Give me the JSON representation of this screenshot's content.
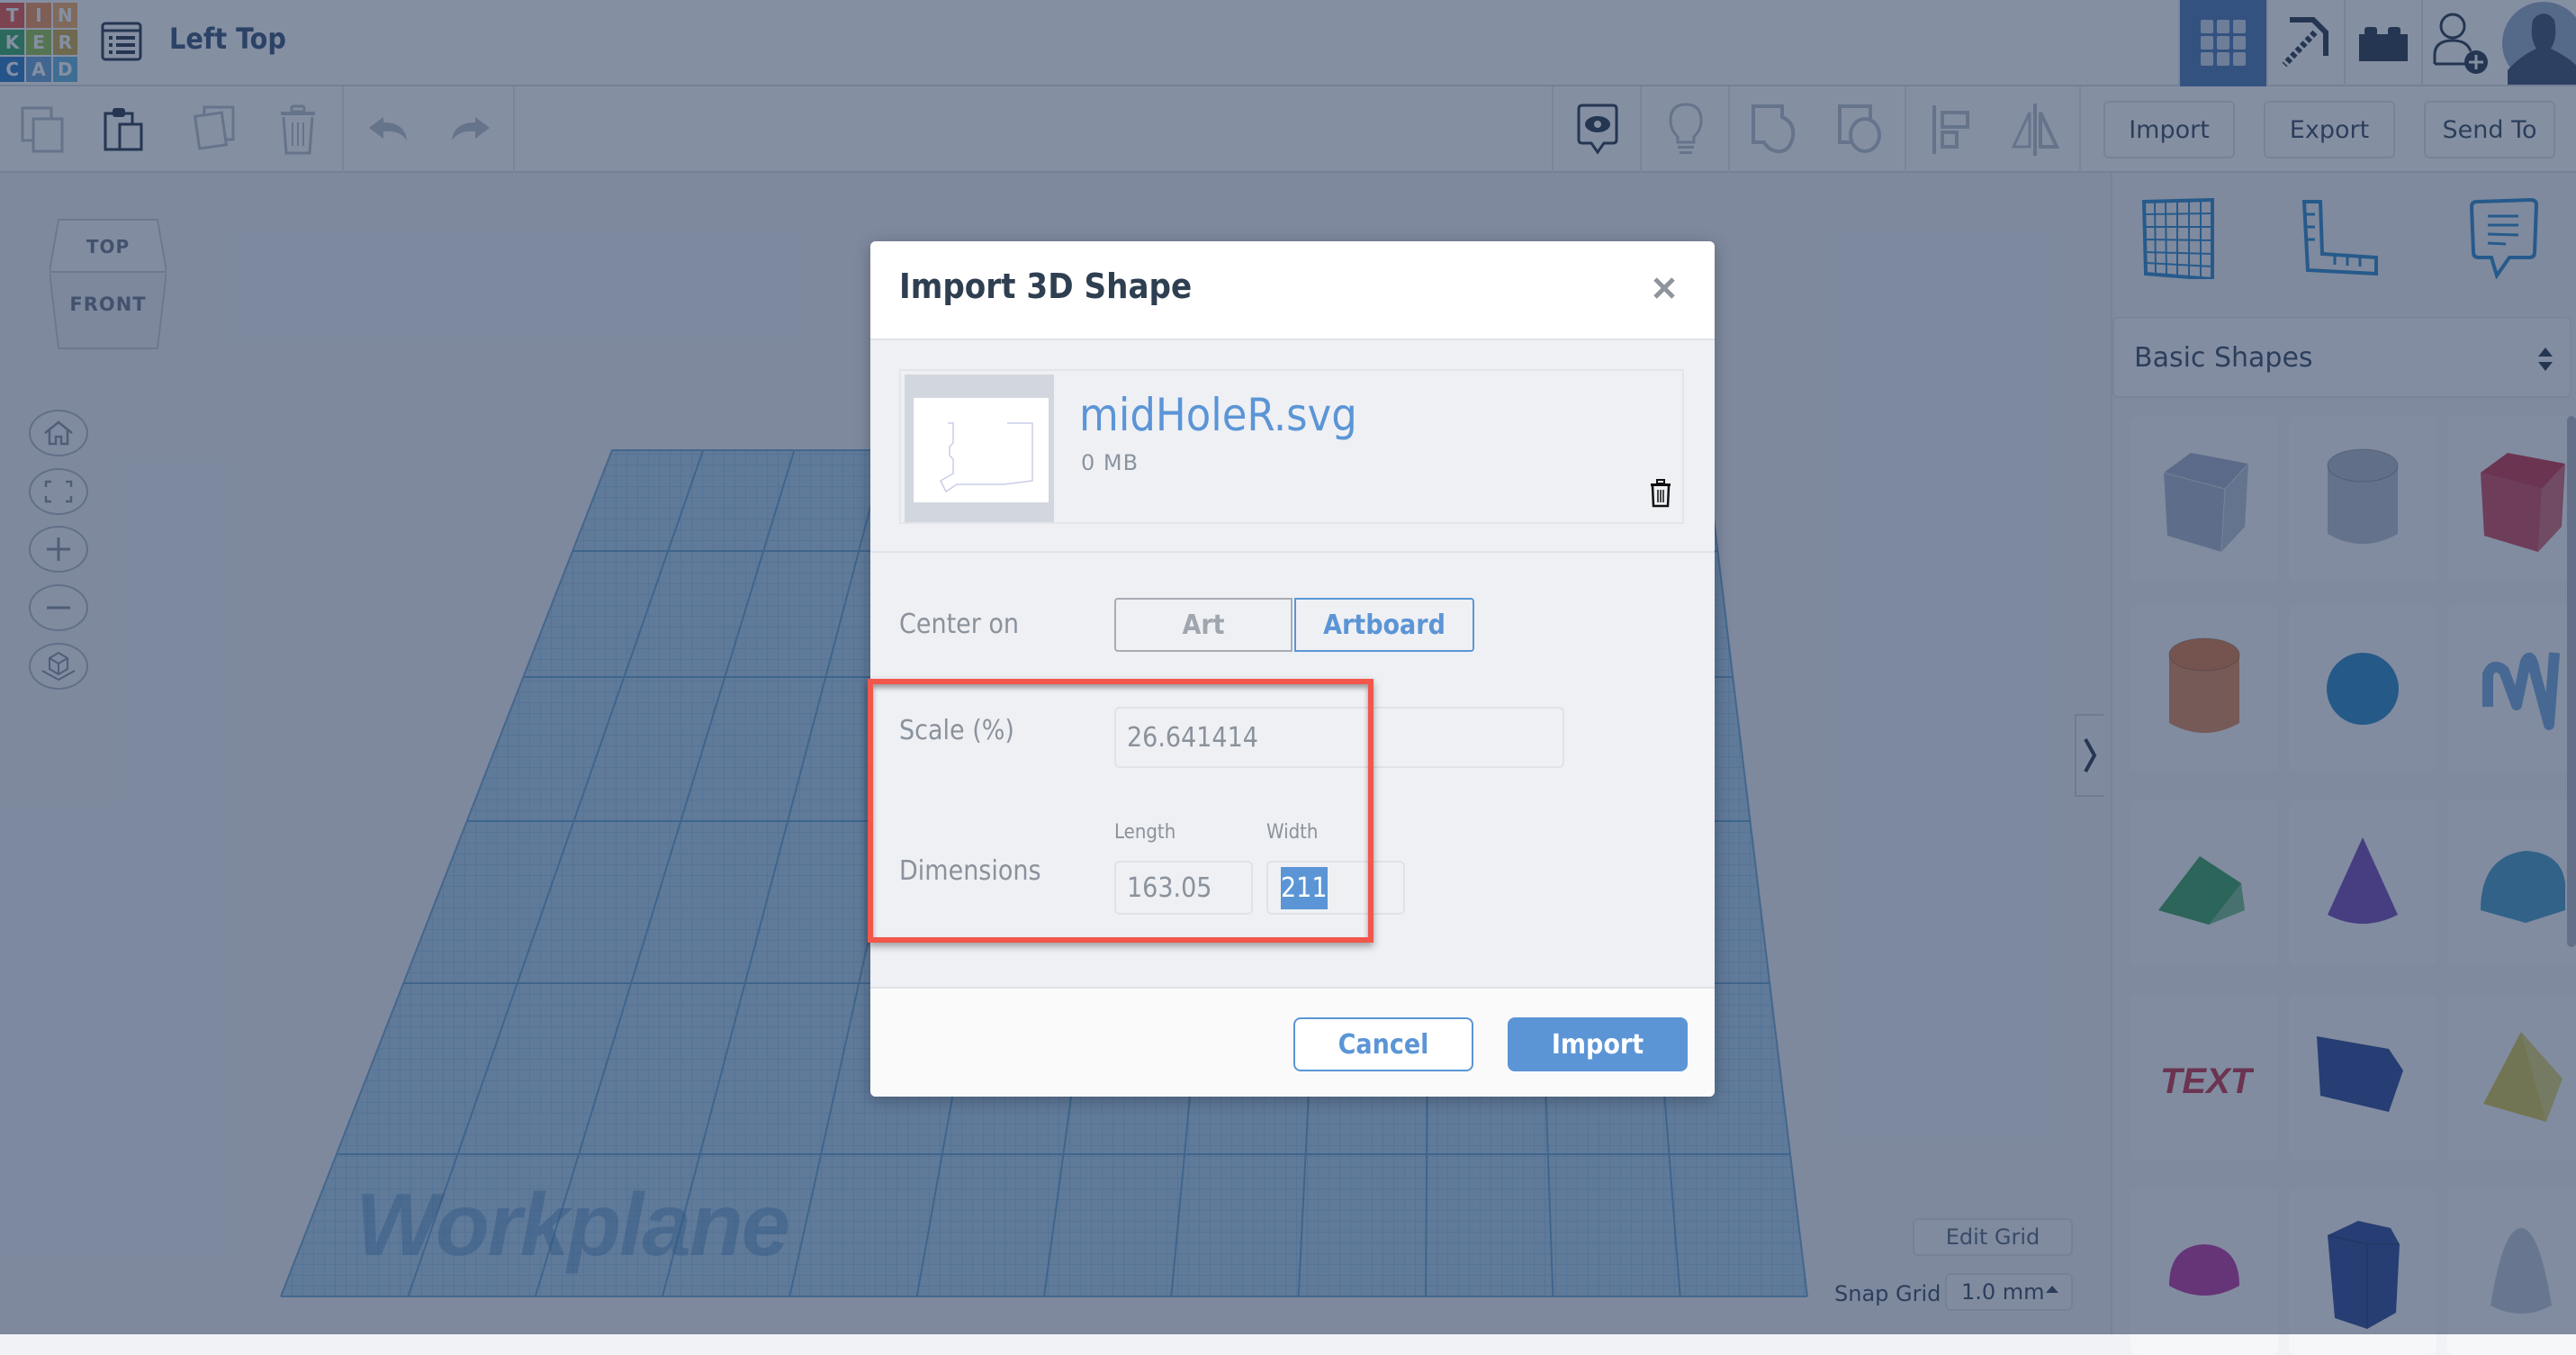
{
  "app": {
    "logo_letters": [
      "T",
      "I",
      "N",
      "K",
      "E",
      "R",
      "C",
      "A",
      "D"
    ],
    "logo_colors": [
      "#e84c3d",
      "#f08a4b",
      "#f2a65a",
      "#2aa55b",
      "#8cbf3f",
      "#c9a43a",
      "#1c73c6",
      "#5d9ed8",
      "#5ab1de"
    ],
    "design_title": "Left Top"
  },
  "topbar": {
    "icons": [
      {
        "name": "3d-design-grid-icon",
        "active": true
      },
      {
        "name": "minecraft-pickaxe-icon",
        "active": false
      },
      {
        "name": "lego-brick-icon",
        "active": false
      },
      {
        "name": "add-user-icon",
        "active": false
      },
      {
        "name": "user-avatar",
        "active": false
      }
    ]
  },
  "toolbar": {
    "left_icons": [
      "copy-icon",
      "paste-icon",
      "duplicate-icon",
      "delete-icon",
      "undo-icon",
      "redo-icon"
    ],
    "right_icons": [
      "show-notes-icon",
      "lightbulb-icon",
      "group-icon",
      "ungroup-icon",
      "align-icon",
      "mirror-icon"
    ],
    "import_label": "Import",
    "export_label": "Export",
    "sendto_label": "Send To"
  },
  "viewcube": {
    "top_label": "TOP",
    "front_label": "FRONT"
  },
  "nav_buttons": [
    "home-view-icon",
    "fit-view-icon",
    "zoom-in-icon",
    "zoom-out-icon",
    "perspective-icon"
  ],
  "workplane": {
    "label": "Workplane",
    "edit_grid_label": "Edit Grid",
    "snap_grid_label": "Snap Grid",
    "snap_grid_value": "1.0 mm"
  },
  "right_panel": {
    "tool_icons": [
      "workplane-icon",
      "ruler-icon",
      "notes-icon"
    ],
    "category": "Basic Shapes",
    "shapes": [
      {
        "name": "box-hole",
        "color": "#9aa8c0"
      },
      {
        "name": "cylinder-hole",
        "color": "#a9b3c4"
      },
      {
        "name": "box",
        "color": "#c2283e"
      },
      {
        "name": "cylinder",
        "color": "#d9733a"
      },
      {
        "name": "sphere",
        "color": "#1c7fc2"
      },
      {
        "name": "scribble",
        "color": "#6aa3dc"
      },
      {
        "name": "roof",
        "color": "#2e9c54"
      },
      {
        "name": "cone",
        "color": "#6a3fb0"
      },
      {
        "name": "round-roof",
        "color": "#3a93c0"
      },
      {
        "name": "text",
        "color": "#c2283e"
      },
      {
        "name": "wedge",
        "color": "#1d3f8f"
      },
      {
        "name": "pyramid",
        "color": "#d2c244"
      },
      {
        "name": "half-sphere",
        "color": "#b62a9b"
      },
      {
        "name": "polygon",
        "color": "#1d3f8f"
      },
      {
        "name": "paraboloid",
        "color": "#b9c4d2"
      }
    ]
  },
  "dialog": {
    "title": "Import 3D Shape",
    "file": {
      "name": "midHoleR.svg",
      "size": "0 MB"
    },
    "center_on_label": "Center on",
    "center_on_options": [
      "Art",
      "Artboard"
    ],
    "center_on_selected": "Artboard",
    "scale_label": "Scale (%)",
    "scale_value": "26.641414",
    "dimensions_label": "Dimensions",
    "length_label": "Length",
    "length_value": "163.05",
    "width_label": "Width",
    "width_value": "211",
    "cancel_label": "Cancel",
    "import_label": "Import"
  },
  "annotation": {
    "highlight_color": "#f2574b"
  }
}
